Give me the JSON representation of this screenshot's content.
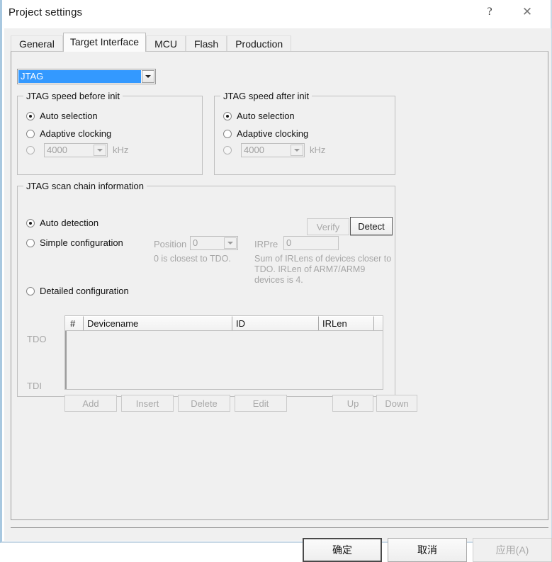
{
  "window": {
    "title": "Project settings",
    "help_icon": "question-mark-icon",
    "close_icon": "close-icon"
  },
  "tabs": [
    {
      "label": "General",
      "active": false
    },
    {
      "label": "Target Interface",
      "active": true
    },
    {
      "label": "MCU",
      "active": false
    },
    {
      "label": "Flash",
      "active": false
    },
    {
      "label": "Production",
      "active": false
    }
  ],
  "protocol_combo": {
    "value": "JTAG",
    "selected_bg": "#3399ff"
  },
  "speed_before": {
    "legend": "JTAG speed before init",
    "options": [
      {
        "label": "Auto selection",
        "checked": true,
        "disabled": false
      },
      {
        "label": "Adaptive clocking",
        "checked": false,
        "disabled": false
      },
      {
        "label": "",
        "checked": false,
        "disabled": true
      }
    ],
    "khz_value": "4000",
    "unit": "kHz"
  },
  "speed_after": {
    "legend": "JTAG speed after init",
    "options": [
      {
        "label": "Auto selection",
        "checked": true,
        "disabled": false
      },
      {
        "label": "Adaptive clocking",
        "checked": false,
        "disabled": false
      },
      {
        "label": "",
        "checked": false,
        "disabled": true
      }
    ],
    "khz_value": "4000",
    "unit": "kHz"
  },
  "scan_chain": {
    "legend": "JTAG scan chain information",
    "verify_button": "Verify",
    "detect_button": "Detect",
    "auto_detection": "Auto detection",
    "simple_configuration": "Simple configuration",
    "detailed_configuration": "Detailed configuration",
    "position_label": "Position",
    "position_value": "0",
    "position_hint": "0 is closest to TDO.",
    "irpre_label": "IRPre",
    "irpre_value": "0",
    "irpre_hint": "Sum of IRLens of devices closer to\nTDO. IRLen of ARM7/ARM9\ndevices is 4.",
    "tdo_label": "TDO",
    "tdi_label": "TDI",
    "columns": [
      "#",
      "Devicename",
      "ID",
      "IRLen",
      ""
    ],
    "rows": [],
    "actions": [
      "Add",
      "Insert",
      "Delete",
      "Edit",
      "Up",
      "Down"
    ]
  },
  "footer": {
    "ok_label": "确定",
    "cancel_label": "取消",
    "apply_label": "应用(A)"
  }
}
